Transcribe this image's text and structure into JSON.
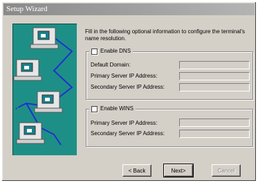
{
  "window": {
    "title": "Setup Wizard"
  },
  "intro": "Fill in the following optional information to configure the terminal's name resolution.",
  "dns": {
    "checkbox_label": "Enable DNS",
    "fields": [
      {
        "label": "Default Domain:",
        "value": ""
      },
      {
        "label": "Primary Server IP Address:",
        "value": ""
      },
      {
        "label": "Secondary Server IP Address:",
        "value": ""
      }
    ]
  },
  "wins": {
    "checkbox_label": "Enable WINS",
    "fields": [
      {
        "label": "Primary Server IP Address:",
        "value": ""
      },
      {
        "label": "Secondary Server IP Address:",
        "value": ""
      }
    ]
  },
  "buttons": {
    "back": "< Back",
    "next": "Next>",
    "cancel": "Cancel"
  },
  "colors": {
    "art_bg": "#1e8f86",
    "cable": "#2030d0"
  },
  "art_icons": [
    "computer-icon",
    "computer-icon",
    "computer-icon",
    "computer-icon"
  ]
}
